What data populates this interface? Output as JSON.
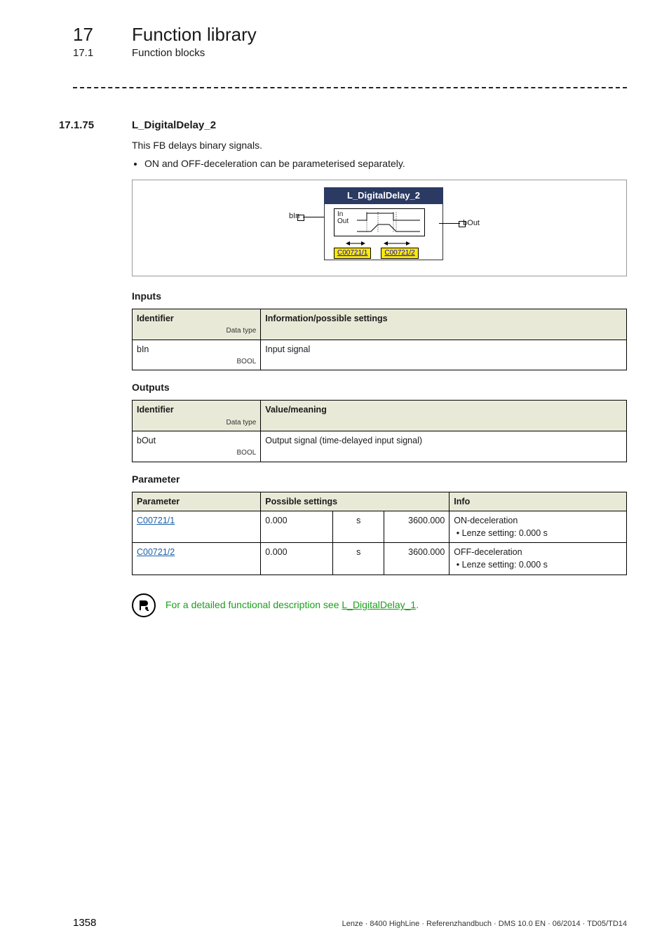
{
  "chapter": {
    "num": "17",
    "title": "Function library"
  },
  "subchapter": {
    "num": "17.1",
    "title": "Function blocks"
  },
  "section": {
    "num": "17.1.75",
    "title": "L_DigitalDelay_2"
  },
  "intro": {
    "line1": "This FB delays binary signals.",
    "bullet1": "ON and OFF-deceleration can be parameterised separately."
  },
  "diagram": {
    "title": "L_DigitalDelay_2",
    "pin_left": "bIn",
    "pin_right": "bOut",
    "inner_in": "In",
    "inner_out": "Out",
    "code_left": "C00721/1",
    "code_right": "C00721/2"
  },
  "headings": {
    "inputs": "Inputs",
    "outputs": "Outputs",
    "parameter": "Parameter"
  },
  "table_labels": {
    "identifier": "Identifier",
    "data_type": "Data type",
    "info_settings": "Information/possible settings",
    "value_meaning": "Value/meaning",
    "parameter": "Parameter",
    "possible_settings": "Possible settings",
    "info": "Info"
  },
  "inputs_table": {
    "rows": [
      {
        "ident": "bIn",
        "dtype": "BOOL",
        "desc": "Input signal"
      }
    ]
  },
  "outputs_table": {
    "rows": [
      {
        "ident": "bOut",
        "dtype": "BOOL",
        "desc": "Output signal (time-delayed input signal)"
      }
    ]
  },
  "params_table": {
    "rows": [
      {
        "param": "C00721/1",
        "min": "0.000",
        "unit": "s",
        "max": "3600.000",
        "info_title": "ON-deceleration",
        "info_sub": "Lenze setting: 0.000 s"
      },
      {
        "param": "C00721/2",
        "min": "0.000",
        "unit": "s",
        "max": "3600.000",
        "info_title": "OFF-deceleration",
        "info_sub": "Lenze setting: 0.000 s"
      }
    ]
  },
  "tip": {
    "prefix": "For a detailed functional description see ",
    "link": "L_DigitalDelay_1",
    "suffix": "."
  },
  "footer": {
    "page": "1358",
    "right": "Lenze · 8400 HighLine · Referenzhandbuch · DMS 10.0 EN · 06/2014 · TD05/TD14"
  }
}
